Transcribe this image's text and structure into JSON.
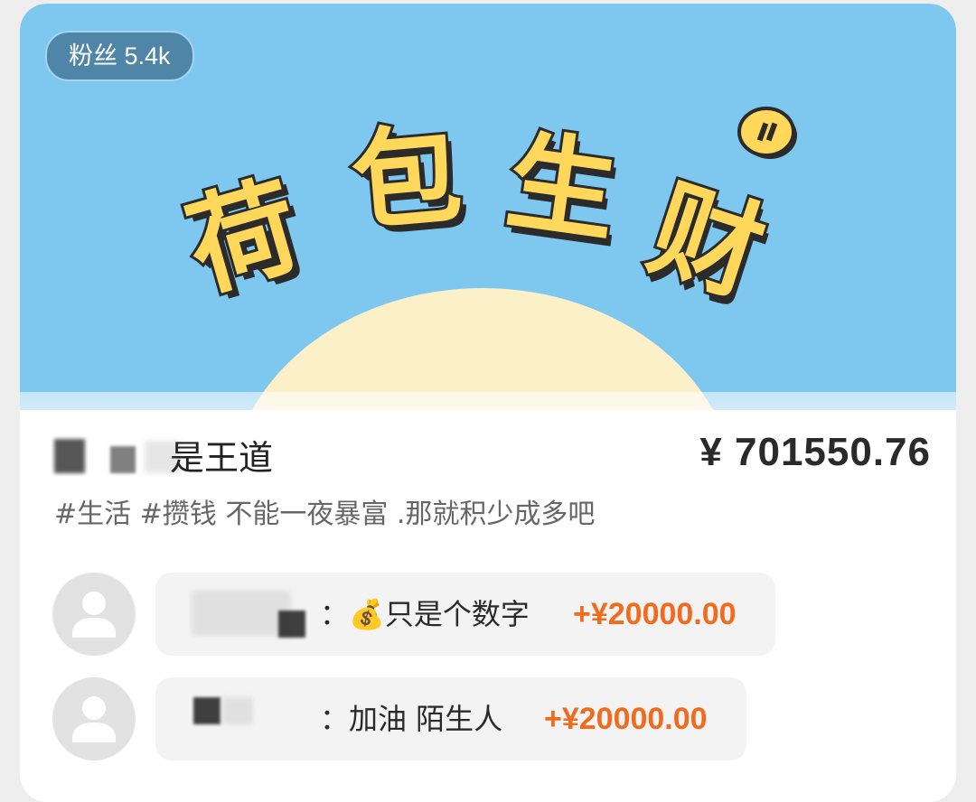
{
  "banner": {
    "fans_badge": "粉丝 5.4k",
    "title_chars": [
      "荷",
      "包",
      "生",
      "财"
    ],
    "coin_icon": "coin-icon",
    "colors": {
      "sky": "#7ec8f0",
      "sun": "#fbf0c8",
      "title_fill": "#ffd75a"
    }
  },
  "info": {
    "name": "是王道",
    "amount": "¥ 701550.76",
    "description": "#生活 #攒钱  不能一夜暴富 .那就积少成多吧"
  },
  "comments": [
    {
      "avatar_icon": "user-avatar-icon",
      "text": "：💰只是个数字",
      "amount": "+¥20000.00"
    },
    {
      "avatar_icon": "user-avatar-icon",
      "text": "：加油 陌生人",
      "amount": "+¥20000.00"
    }
  ],
  "accent_color": "#f06b1e"
}
